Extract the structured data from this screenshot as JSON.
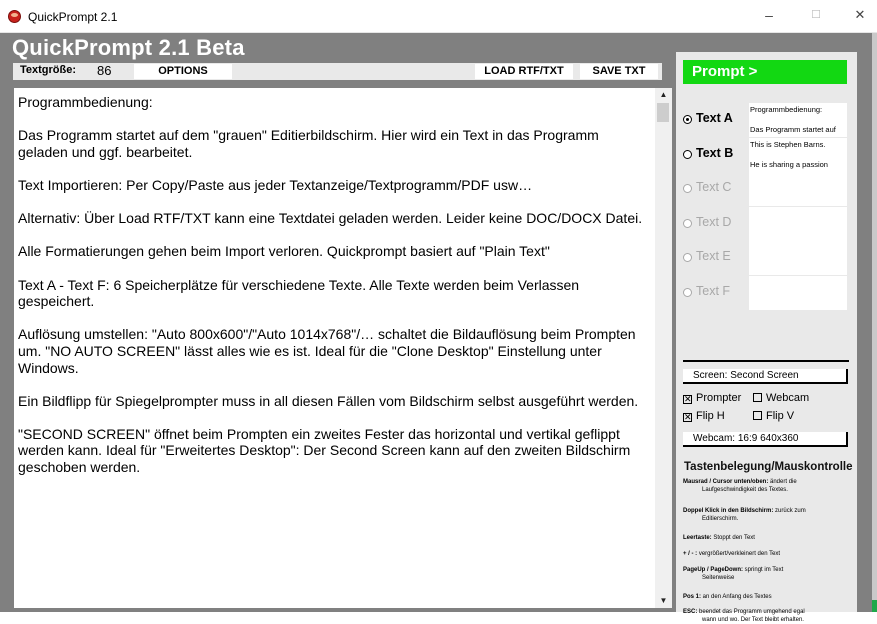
{
  "window": {
    "title": "QuickPrompt 2.1",
    "minimize": "–",
    "maximize": "☐",
    "close": "✕"
  },
  "app": {
    "title": "QuickPrompt 2.1 Beta"
  },
  "toolbar": {
    "font_size_label": "Textgröße:",
    "font_size_value": "86",
    "options": "OPTIONS",
    "load": "LOAD RTF/TXT",
    "save": "SAVE TXT"
  },
  "editor": {
    "paragraphs": [
      "Programmbedienung:",
      "Das Programm startet auf dem \"grauen\" Editierbildschirm. Hier wird ein Text in das Programm geladen und ggf. bearbeitet.",
      "Text Importieren: Per Copy/Paste aus jeder Textanzeige/Textprogramm/PDF usw…",
      "Alternativ: Über Load RTF/TXT kann eine Textdatei geladen werden. Leider keine DOC/DOCX Datei.",
      "Alle Formatierungen gehen beim Import verloren. Quickprompt basiert auf \"Plain Text\"",
      "Text A - Text F: 6 Speicherplätze für verschiedene Texte. Alle Texte werden beim Verlassen gespeichert.",
      "Auflösung umstellen: \"Auto 800x600\"/\"Auto 1014x768\"/… schaltet die Bildauflösung beim Prompten um. \"NO AUTO SCREEN\" lässt alles wie es ist. Ideal für die \"Clone Desktop\" Einstellung unter Windows.",
      "Ein Bildflipp für Spiegelprompter muss in all diesen Fällen vom Bildschirm selbst ausgeführt werden.",
      "\"SECOND SCREEN\" öffnet beim Prompten ein zweites Fester das horizontal und vertikal geflippt werden kann. Ideal für \"Erweitertes Desktop\": Der Second Screen kann auf den zweiten Bildschirm geschoben werden."
    ]
  },
  "panel": {
    "prompt_button": "Prompt >",
    "slots": [
      {
        "label": "Text A",
        "selected": true,
        "active": true,
        "preview": [
          "Programmbedienung:",
          "",
          "Das Programm startet auf"
        ]
      },
      {
        "label": "Text B",
        "selected": false,
        "active": true,
        "preview": [
          "This is Stephen Barns.",
          "",
          "He is sharing a passion"
        ]
      },
      {
        "label": "Text C",
        "selected": false,
        "active": false,
        "preview": []
      },
      {
        "label": "Text D",
        "selected": false,
        "active": false,
        "preview": []
      },
      {
        "label": "Text E",
        "selected": false,
        "active": false,
        "preview": []
      },
      {
        "label": "Text F",
        "selected": false,
        "active": false,
        "preview": []
      }
    ],
    "screen_field": "Screen: Second Screen",
    "checks": {
      "prompter": "Prompter",
      "webcam": "Webcam",
      "flip_h": "Flip H",
      "flip_v": "Flip V"
    },
    "checked": {
      "prompter": true,
      "webcam": false,
      "flip_h": true,
      "flip_v": false
    },
    "webcam_field": "Webcam: 16:9 640x360",
    "keys_title": "Tastenbelegung/Mauskontrolle",
    "keys": [
      {
        "key": "Mausrad / Cursor unten/oben:",
        "line1": " ändert die",
        "line2": "Laufgeschwindigkeit des Textes."
      },
      {
        "key": "Doppel Klick in den Bildschirm:",
        "line1": " zurück zum",
        "line2": "Editierschirm."
      },
      {
        "key": "Leertaste:",
        "line1": " Stoppt den Text",
        "line2": ""
      },
      {
        "key": "+ / - :",
        "line1": " vergrößert/verkleinert den Text",
        "line2": ""
      },
      {
        "key": "PageUp / PageDown:",
        "line1": " springt im Text",
        "line2": "Seitenweise"
      },
      {
        "key": "Pos 1:",
        "line1": " an den Anfang des Textes",
        "line2": ""
      },
      {
        "key": "ESC:",
        "line1": " beendet das Programm umgehend egal",
        "line2": "wann und wo. Der Text bleibt erhalten."
      }
    ]
  }
}
